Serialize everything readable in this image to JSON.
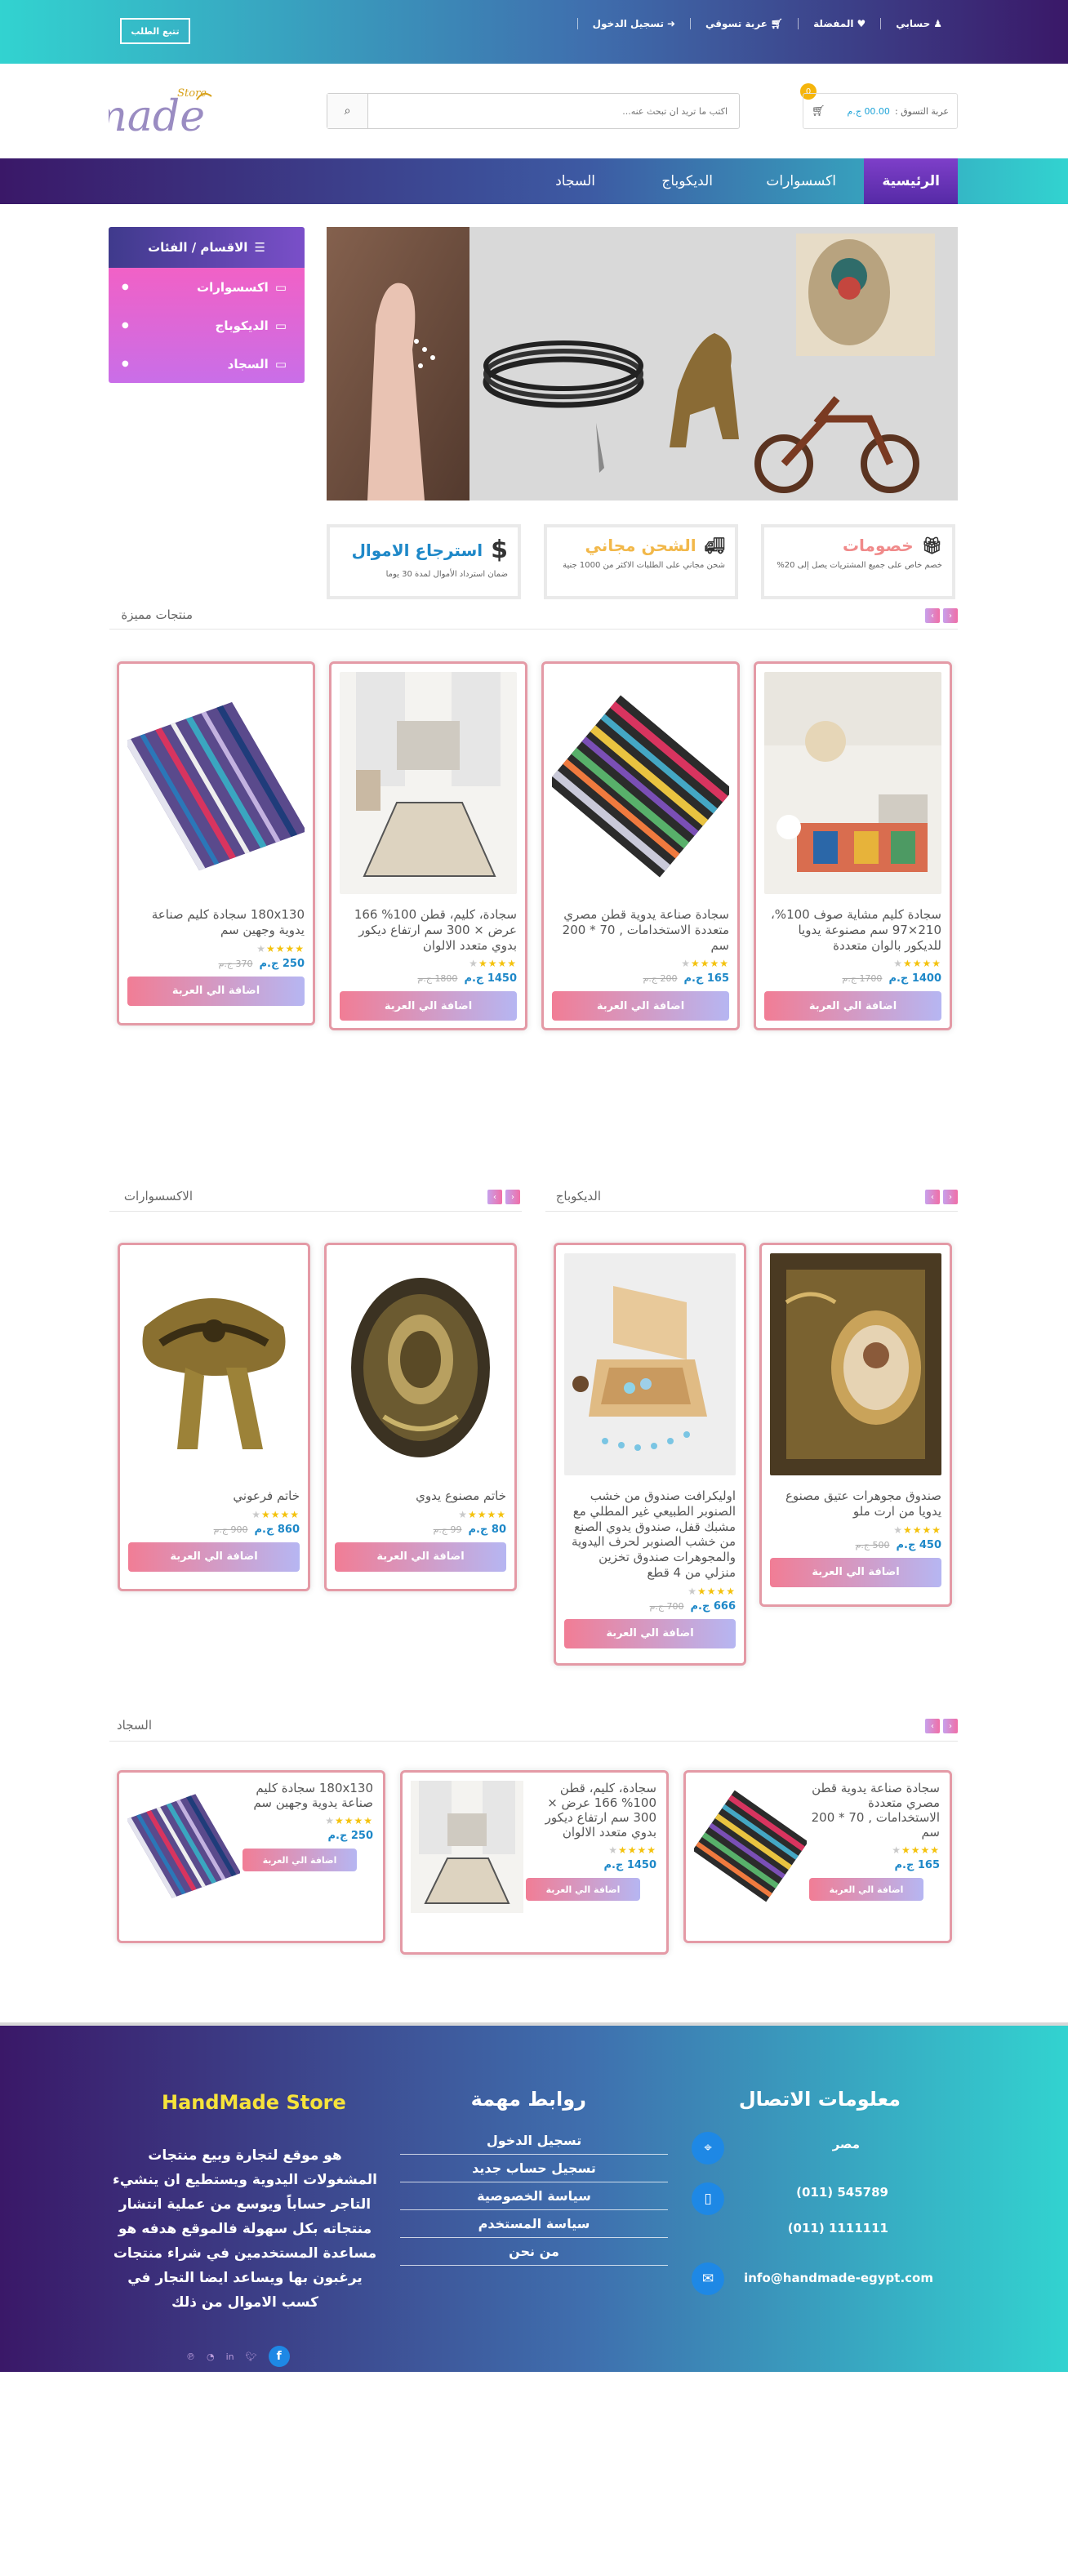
{
  "topbar": {
    "links": [
      "حسابي",
      "المفضلة",
      "عربة تسوقي",
      "تسجيل الدخول"
    ],
    "track_order": "تتبع الطلب"
  },
  "header": {
    "logo_text": "Handmade",
    "logo_small": "Store",
    "search_placeholder": "اكتب ما تريد ان تبحث عنه...",
    "cart_label": "عربة التسوق :",
    "cart_amount": "00.00 ج.م",
    "cart_count": "0"
  },
  "nav": {
    "items": [
      "الرئيسية",
      "اكسسوارات",
      "الديكوباج",
      "السجاد"
    ]
  },
  "sidebar": {
    "title": "الاقسام / الفئات",
    "items": [
      "اكسسوارات",
      "الديكوباج",
      "السجاد"
    ]
  },
  "features": [
    {
      "title": "خصومات",
      "sub": "خصم خاص على جميع المشتريات يصل إلى 20%"
    },
    {
      "title": "الشحن مجاني",
      "sub": "شحن مجاني على الطلبات الاكثر من 1000 جنية"
    },
    {
      "title": "استرجاع الاموال",
      "sub": "ضمان استرداد الأموال لمدة 30 يوما"
    }
  ],
  "featured": {
    "title": "منتجات مميزة",
    "products": [
      {
        "name": "سجادة كليم مشاية صوف 100%، 210×97 سم مصنوعة يدويا للديكور بالوان متعددة",
        "price": "1400 ج.م",
        "old": "1700 ج.م",
        "rating": 4,
        "add": "اضافة الي العربة"
      },
      {
        "name": "سجادة صناعة يدوية قطن مصري متعددة الاستخدامات , 70 * 200 سم",
        "price": "165 ج.م",
        "old": "200 ج.م",
        "rating": 4,
        "add": "اضافة الي العربة"
      },
      {
        "name": "سجادة، كليم، قطن 100% 166 عرض × 300 سم ارتفاع ديكور بدوي متعدد الالوان",
        "price": "1450 ج.م",
        "old": "1800 ج.م",
        "rating": 4,
        "add": "اضافة الي العربة"
      },
      {
        "name": "180x130 سجادة كليم صناعة يدوية وجهين سم",
        "price": "250 ج.م",
        "old": "370 ج.م",
        "rating": 4,
        "add": "اضافة الي العربة"
      }
    ]
  },
  "decoupage": {
    "title": "الديكوباج",
    "products": [
      {
        "name": "صندوق مجوهرات عتيق مصنوع يدويا من ارت ملو",
        "price": "450 ج.م",
        "old": "500 ج.م",
        "rating": 4,
        "add": "اضافة الي العربة"
      },
      {
        "name": "اوليكرافت صندوق من خشب الصنوبر الطبيعي غير المطلي مع مشبك قفل، صندوق يدوي الصنع من خشب الصنوبر لحرف اليدوية والمجوهرات صندوق تخزين منزلي من 4 قطع",
        "price": "666 ج.م",
        "old": "700 ج.م",
        "rating": 4,
        "add": "اضافة الي العربة"
      }
    ]
  },
  "accessories": {
    "title": "الاكسسوارات",
    "products": [
      {
        "name": "خاتم مصنوع يدوي",
        "price": "80 ج.م",
        "old": "99 ج.م",
        "rating": 4,
        "add": "اضافة الي العربة"
      },
      {
        "name": "خاتم فرعوني",
        "price": "860 ج.م",
        "old": "900 ج.م",
        "rating": 4,
        "add": "اضافة الي العربة"
      }
    ]
  },
  "carpets": {
    "title": "السجاد",
    "products": [
      {
        "name": "سجادة صناعة يدوية قطن مصري متعددة الاستخدامات , 70 * 200 سم",
        "price": "165 ج.م",
        "rating": 4,
        "add": "اضافة الي العربة"
      },
      {
        "name": "سجادة، كليم، قطن 100% 166 عرض × 300 سم ارتفاع ديكور بدوي متعدد الالوان",
        "price": "1450 ج.م",
        "rating": 4,
        "add": "اضافة الي العربة"
      },
      {
        "name": "180x130 سجادة كليم صناعة يدوية وجهين سم",
        "price": "250 ج.م",
        "rating": 4,
        "add": "اضافة الي العربة"
      }
    ]
  },
  "footer": {
    "contact_title": "معلومات الاتصال",
    "country": "مصر",
    "phone1": "545789 (011)",
    "phone2": "1111111 (011)",
    "email": "info@handmade-egypt.com",
    "links_title": "روابط مهمة",
    "links": [
      "تسجيل الدخول",
      "تسجيل حساب جديد",
      "سياسة الخصوصية",
      "سياسة المستخدم",
      "من نحن"
    ],
    "store_title": "HandMade Store",
    "about": "هو موقع لتجارة وبيع منتجات المشغولات اليدوية ويستطيع ان ينشيء التاجر حساباً ويوسع من عملية انتشار منتجاته بكل سهولة فالموقع هدفه هو مساعدة المستخدمين في شراء منتجات يرغبون بها ويساعد ايضا التجار في كسب الاموال من ذلك"
  }
}
